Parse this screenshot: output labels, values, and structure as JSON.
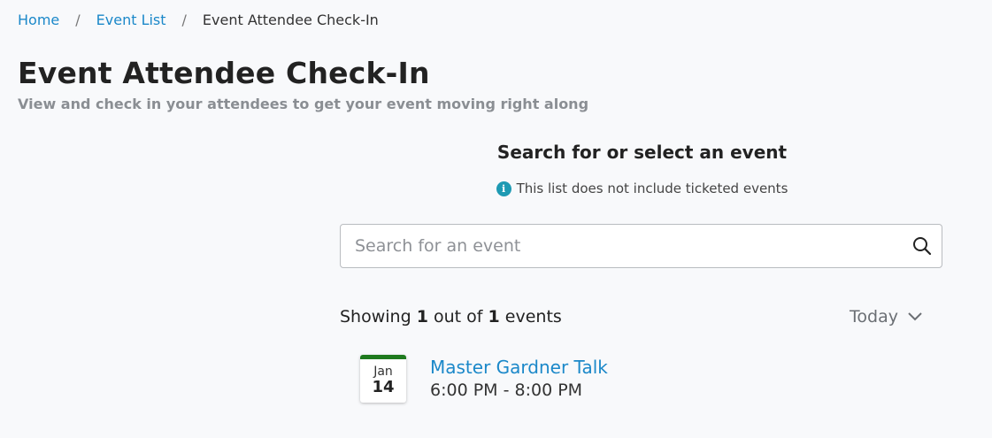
{
  "breadcrumb": {
    "items": [
      {
        "label": "Home"
      },
      {
        "label": "Event List"
      }
    ],
    "separator": "/",
    "current": "Event Attendee Check-In"
  },
  "page": {
    "title": "Event Attendee Check-In",
    "subtitle": "View and check in your attendees to get your event moving right along"
  },
  "panel": {
    "heading": "Search for or select an event",
    "notice": "This list does not include ticketed events",
    "notice_icon": "info-icon"
  },
  "search": {
    "placeholder": "Search for an event",
    "value": "",
    "icon": "search-icon"
  },
  "results": {
    "prefix": "Showing",
    "shown": "1",
    "middle": "out of",
    "total": "1",
    "suffix": "events",
    "date_filter": "Today"
  },
  "events": [
    {
      "month": "Jan",
      "day": "14",
      "title": "Master Gardner Talk",
      "time": "6:00 PM - 8:00 PM"
    }
  ],
  "colors": {
    "link": "#1b88c9",
    "calendar_accent": "#1e7a1e",
    "info_icon": "#1e9ab3",
    "background": "#f8f9fb"
  }
}
